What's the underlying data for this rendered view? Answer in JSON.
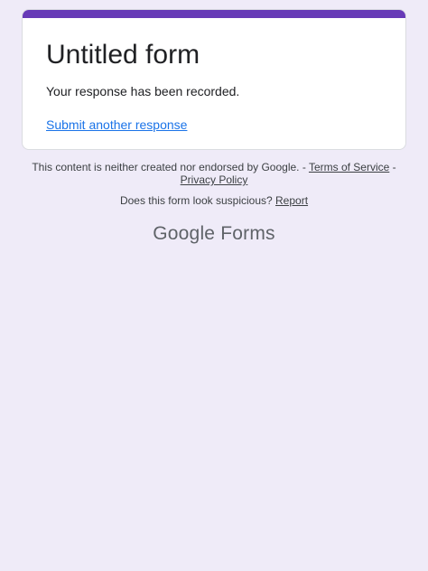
{
  "card": {
    "title": "Untitled form",
    "confirmation": "Your response has been recorded.",
    "submit_another": "Submit another response"
  },
  "footer": {
    "disclaimer_text": "This content is neither created nor endorsed by Google. - ",
    "terms_label": "Terms of Service",
    "separator": " - ",
    "privacy_label": "Privacy Policy",
    "suspicious_text": "Does this form look suspicious? ",
    "report_label": "Report"
  },
  "brand": {
    "google": "Google",
    "product": "Forms"
  },
  "colors": {
    "accent": "#673ab7",
    "link": "#1a73e8",
    "background": "#efebf8"
  }
}
